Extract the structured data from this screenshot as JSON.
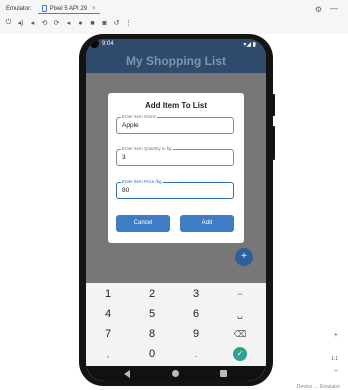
{
  "emulator": {
    "label": "Emulator:",
    "device_tab": "Pixel 5 API 29",
    "tab_close": "×",
    "settings_icon": "gear-icon",
    "minimize": "—",
    "toolbar_icons": [
      "power-icon",
      "volume-up-icon",
      "volume-down-icon",
      "rotate-left-icon",
      "rotate-right-icon",
      "back-icon",
      "home-icon",
      "stop-icon",
      "camera-icon",
      "undo-icon",
      "more-icon"
    ]
  },
  "status_bar": {
    "time": "9:04",
    "indicators": "▾◢ ▮"
  },
  "app": {
    "title": "My Shopping List"
  },
  "dialog": {
    "title": "Add Item To List",
    "fields": [
      {
        "label": "Enter Item Name",
        "value": "Apple"
      },
      {
        "label": "Enter Item Quantity in kg",
        "value": "3"
      },
      {
        "label": "Enter Item Price /kg",
        "value": "80"
      }
    ],
    "cancel_label": "Cancel",
    "add_label": "Add"
  },
  "fab": {
    "label": "+"
  },
  "keyboard": {
    "rows": [
      [
        "1",
        "2",
        "3",
        "−"
      ],
      [
        "4",
        "5",
        "6",
        "␣"
      ],
      [
        "7",
        "8",
        "9",
        "⌫"
      ],
      [
        ",",
        "0",
        ".",
        "✓"
      ]
    ]
  },
  "side_controls": {
    "zoom_in": "+",
    "zoom_ratio": "1:1",
    "zoom_out": "−"
  },
  "footer": "Device … Emulator"
}
